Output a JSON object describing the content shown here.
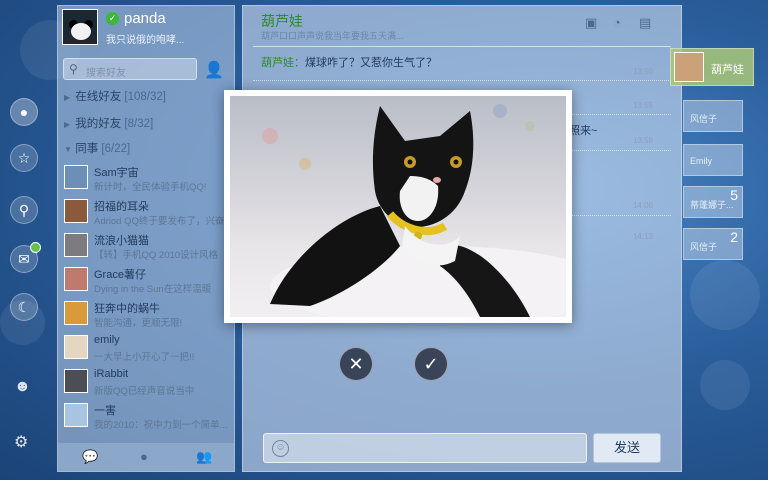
{
  "profile": {
    "nickname": "panda",
    "signature": "我只说俄的咆哮..."
  },
  "search": {
    "placeholder": "搜索好友"
  },
  "groups": [
    {
      "label": "在线好友",
      "count": "[108/32]",
      "expanded": false
    },
    {
      "label": "我的好友",
      "count": "[8/32]",
      "expanded": false
    },
    {
      "label": "同事",
      "count": "[6/22]",
      "expanded": true
    }
  ],
  "contacts": [
    {
      "name": "Sam宇宙",
      "message": "新计时，全民体验手机QQ!"
    },
    {
      "name": "招福的耳朵",
      "message": "Adriod QQ终于要发布了，兴奋..."
    },
    {
      "name": "流浪小猫猫",
      "message": "【转】手机QQ 2010设计风格"
    },
    {
      "name": "Grace薯仔",
      "message": "Dying in the Sun在这样温暖"
    },
    {
      "name": "狂奔中的蜗牛",
      "message": "智能沟通，更顺无限!"
    },
    {
      "name": "emily",
      "message": "一大早上小开心了一把!!"
    },
    {
      "name": "iRabbit",
      "message": "新版QQ已经声音说当中"
    },
    {
      "name": "一害",
      "message": "我的2010：祝中力到一个简单..."
    }
  ],
  "chat": {
    "title": "葫芦娃",
    "subtitle": "葫芦口口声声说我当年要我五天满...",
    "messages": [
      {
        "sender": "葫芦娃：",
        "text": "煤球咋了？又惹你生气了？",
        "time": "13:50"
      },
      {
        "sender": "",
        "text": "",
        "time": "13:55"
      },
      {
        "sender": "",
        "text": "照来~",
        "time": "13:58"
      },
      {
        "sender": "",
        "text": "",
        "time": "14:06"
      },
      {
        "sender": "",
        "text": "",
        "time": "14:13"
      }
    ],
    "send_label": "发送"
  },
  "sessions": [
    {
      "name": "葫芦娃",
      "count": "",
      "active": true
    },
    {
      "name": "风信子",
      "count": "",
      "active": false
    },
    {
      "name": "Emily",
      "count": "",
      "active": false
    },
    {
      "name": "蒂蓬娜子...",
      "count": "5",
      "active": false
    },
    {
      "name": "风信子",
      "count": "2",
      "active": false
    }
  ],
  "overlay": {
    "subject": "tuxedo cat with yellow collar"
  },
  "colors": {
    "accent_green": "#2e8b2e",
    "online": "#3fb53a",
    "background": "#2a5e9c"
  }
}
